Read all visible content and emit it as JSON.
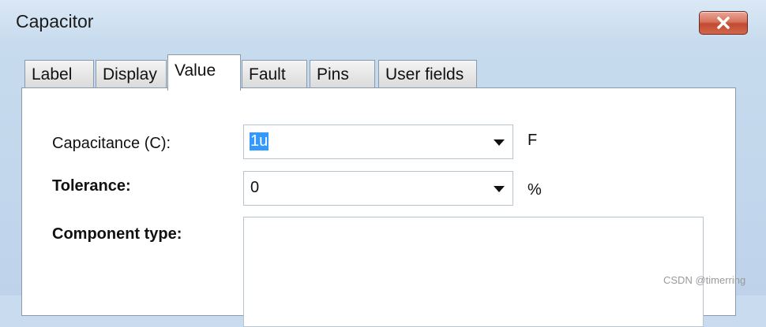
{
  "window": {
    "title": "Capacitor"
  },
  "tabs": [
    {
      "label": "Label"
    },
    {
      "label": "Display"
    },
    {
      "label": "Value",
      "active": true
    },
    {
      "label": "Fault"
    },
    {
      "label": "Pins"
    },
    {
      "label": "User fields"
    }
  ],
  "fields": {
    "capacitance": {
      "label": "Capacitance (C):",
      "value": "1u",
      "unit": "F"
    },
    "tolerance": {
      "label": "Tolerance:",
      "value": "0",
      "unit": "%"
    },
    "component_type": {
      "label": "Component type:",
      "value": ""
    }
  },
  "watermark": "CSDN @timerring",
  "colors": {
    "close_button": "#c9523a",
    "selection": "#3399ff"
  }
}
